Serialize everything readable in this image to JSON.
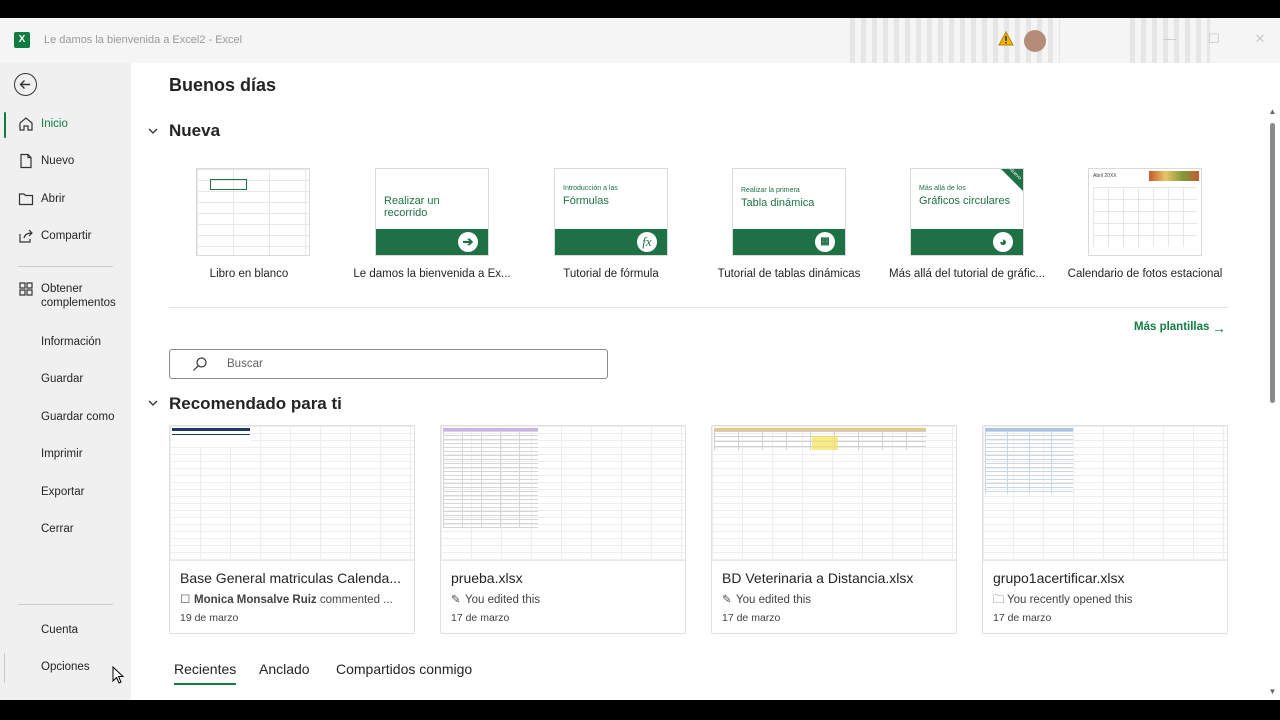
{
  "window": {
    "title": "Le damos la bienvenida a Excel2  -  Excel",
    "app_letter": "X"
  },
  "sidebar": {
    "items": [
      {
        "label": "Inicio",
        "icon": "home-icon"
      },
      {
        "label": "Nuevo",
        "icon": "new-file-icon"
      },
      {
        "label": "Abrir",
        "icon": "folder-icon"
      },
      {
        "label": "Compartir",
        "icon": "share-icon"
      },
      {
        "label": "Obtener complementos",
        "icon": "add-ins-icon"
      },
      {
        "label": "Información"
      },
      {
        "label": "Guardar"
      },
      {
        "label": "Guardar como"
      },
      {
        "label": "Imprimir"
      },
      {
        "label": "Exportar"
      },
      {
        "label": "Cerrar"
      }
    ],
    "bottom_items": [
      {
        "label": "Cuenta"
      },
      {
        "label": "Opciones"
      }
    ]
  },
  "main": {
    "greeting": "Buenos días",
    "new_section": "Nueva",
    "templates": [
      {
        "caption": "Libro en blanco"
      },
      {
        "caption": "Le damos la bienvenida a Ex...",
        "thumb_title": "Realizar un recorrido"
      },
      {
        "caption": "Tutorial de fórmula",
        "thumb_small": "Introducción a las",
        "thumb_title": "Fórmulas"
      },
      {
        "caption": "Tutorial de tablas dinámicas",
        "thumb_small": "Realizar la primera",
        "thumb_title": "Tabla dinámica"
      },
      {
        "caption": "Más allá del tutorial de gráfic...",
        "thumb_small": "Más allá de los",
        "thumb_title": "Gráficos circulares",
        "badge": "Nuevo"
      },
      {
        "caption": "Calendario de fotos estacional",
        "thumb_small": "Abril 20XX"
      }
    ],
    "more_templates": "Más plantillas",
    "search_placeholder": "Buscar",
    "recommended_section": "Recomendado para ti",
    "cards": [
      {
        "file": "Base General matriculas Calenda...",
        "activity_bold": "Monica  Monsalve Ruiz",
        "activity": " commented ...",
        "date": "19 de marzo"
      },
      {
        "file": "prueba.xlsx",
        "activity": "You edited this",
        "date": "17 de marzo"
      },
      {
        "file": "BD Veterinaria a Distancia.xlsx",
        "activity": "You edited this",
        "date": "17 de marzo"
      },
      {
        "file": "grupo1acertificar.xlsx",
        "activity": "You recently opened this",
        "date": "17 de marzo"
      }
    ],
    "tabs": [
      "Recientes",
      "Anclado",
      "Compartidos conmigo"
    ]
  },
  "colors": {
    "accent": "#107c41",
    "band": "#1e7145"
  }
}
